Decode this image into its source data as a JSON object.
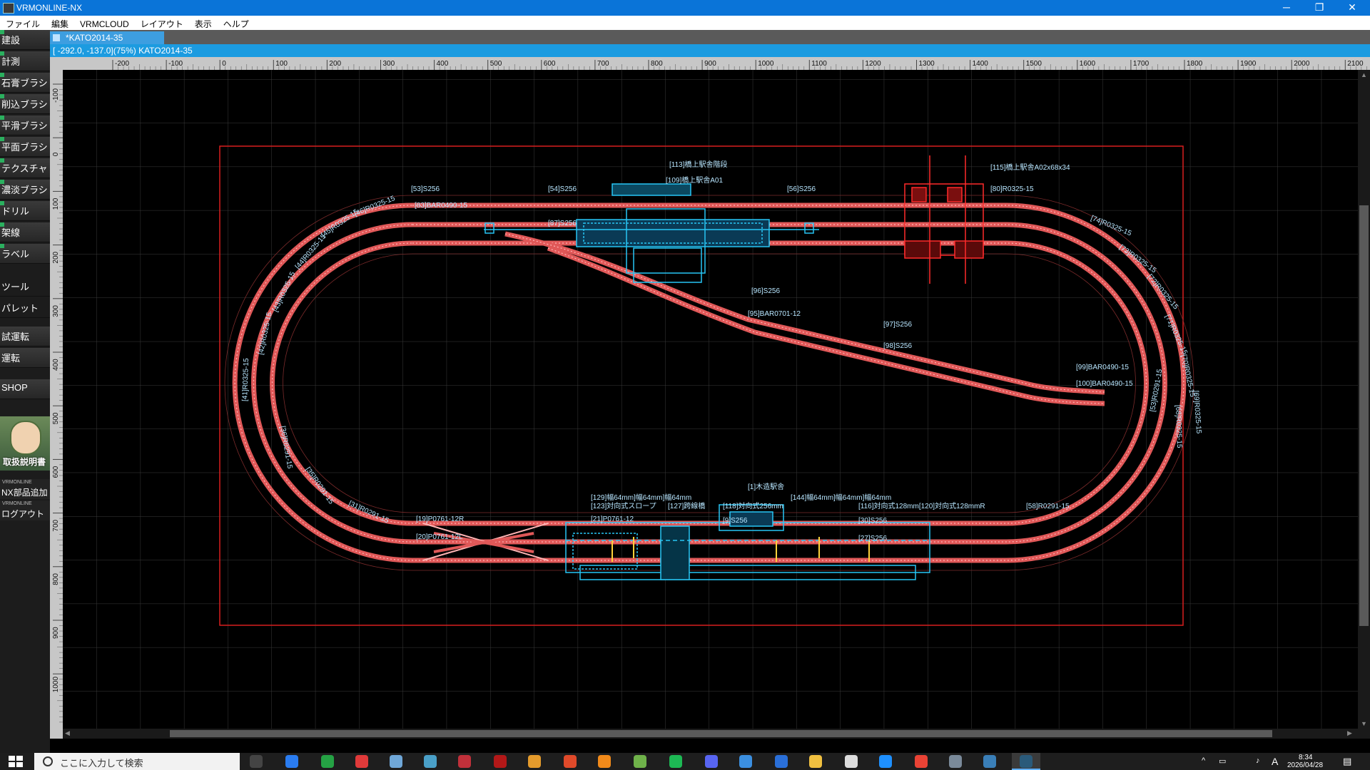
{
  "window": {
    "title": "VRMONLINE-NX",
    "min_glyph": "─",
    "restore_glyph": "❐",
    "close_glyph": "✕"
  },
  "menu": [
    "ファイル",
    "編集",
    "VRMCLOUD",
    "レイアウト",
    "表示",
    "ヘルプ"
  ],
  "sidebar": {
    "items": [
      "建設",
      "計測",
      "石膏ブラシ",
      "削込ブラシ",
      "平滑ブラシ",
      "平面ブラシ",
      "テクスチャ",
      "濃淡ブラシ",
      "ドリル",
      "架線",
      "ラベル"
    ],
    "tools": [
      "ツール",
      "パレット"
    ],
    "run": [
      "試運転",
      "運転",
      "SHOP"
    ],
    "manual": "取扱説明書",
    "footer_brand": "VRMONLINE",
    "add_parts": "NX部品追加",
    "logout": "ログアウト"
  },
  "tab": {
    "label": "*KATO2014-35"
  },
  "status": {
    "coords": "[ -292.0, -137.0](75%)  KATO2014-35"
  },
  "ruler": {
    "top_ticks": [
      "-200",
      "-100",
      "0",
      "100",
      "200",
      "300",
      "400",
      "500",
      "600",
      "700",
      "800",
      "900",
      "1000",
      "1100",
      "1200",
      "1300",
      "1400",
      "1500",
      "1600",
      "1700",
      "1800",
      "1900",
      "2000",
      "2100"
    ],
    "left_ticks": [
      "-100",
      "0",
      "100",
      "200",
      "300",
      "400",
      "500",
      "600",
      "700",
      "800",
      "900",
      "1000"
    ]
  },
  "labels": {
    "station_top": "[113]橋上駅舎階段",
    "station_top2": "[109]橋上駅舎A01",
    "s53": "[53]S256",
    "s54": "[54]S256",
    "s56": "[56]S256",
    "bar83": "[83]BAR0490-15",
    "r46": "[46]R0325-15",
    "r45": "[45]R0325-15",
    "r44": "[44]R0325-15",
    "r43": "[43]R0325-15",
    "r42": "[42]R0325-15",
    "r41": "[41]R0325-15",
    "s87": "[87]S256",
    "s96": "[96]S256",
    "bar95": "[95]BAR0701-12",
    "s97": "[97]S256",
    "s98": "[98]S256",
    "bar99": "[99]BAR0490-15",
    "bar100": "[100]BAR0490-15",
    "r80": "[80]R0325-15",
    "r74": "[74]R0325-15",
    "r73": "[73]R0325-15",
    "r72": "[72]R0325-15",
    "r71": "[71]R0325-15",
    "r70": "[70]R0325-15",
    "r69": "[69]R0325-15",
    "r68": "[68]R0325-15",
    "bridge": "[115]橋上駅舎A02x68x34",
    "sta_bottom": "[1]木造駅舎",
    "p19": "[19]P0761-12R",
    "p20": "[20]P0761-12L",
    "p21": "[21]P0761-12",
    "slope1": "[129]幅64mm]幅64mm]幅64mm",
    "slope2": "[123]対向式スロープ",
    "slope3": "[127]跨線橋",
    "slope4": "[118]対向式256mm",
    "slope5": "[144]幅64mm]幅64mm]幅64mm",
    "slope6": "[116]対向式128mm[120]対向式128mmR",
    "s9": "[9]S256",
    "s30": "[30]S256",
    "s27": "[27]S256",
    "r58": "[58]R0291-15",
    "r53": "[53]R0291-15",
    "r36": "[36]R0291-15",
    "r35": "[35]R0291-15",
    "r31": "[31]R0291-15"
  },
  "taskbar": {
    "search_placeholder": "ここに入力して検索",
    "time": "8:34",
    "date": "2026/04/28",
    "ime": "A"
  },
  "colors": {
    "accent": "#1c9be0",
    "track": "#e05858",
    "track_light": "#ffb4b4",
    "structure_cyan": "#27c6f5",
    "structure_red": "#ff2a2a",
    "board_border": "#d81f1f",
    "label": "#b8e6ff"
  }
}
